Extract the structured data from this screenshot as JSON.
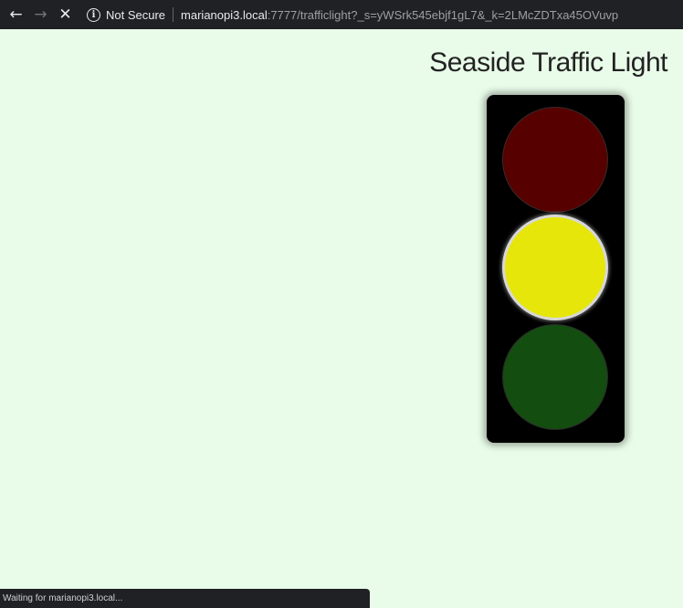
{
  "browser": {
    "not_secure_label": "Not Secure",
    "url_host": "marianopi3.local",
    "url_rest": ":7777/trafficlight?_s=yWSrk545ebjf1gL7&_k=2LMcZDTxa45OVuvp",
    "status_text": "Waiting for marianopi3.local..."
  },
  "page": {
    "title": "Seaside Traffic Light"
  },
  "traffic_light": {
    "active_lamp": "yellow",
    "lamps": {
      "red": "#560000",
      "yellow": "#e6e60a",
      "green": "#134d10"
    }
  }
}
